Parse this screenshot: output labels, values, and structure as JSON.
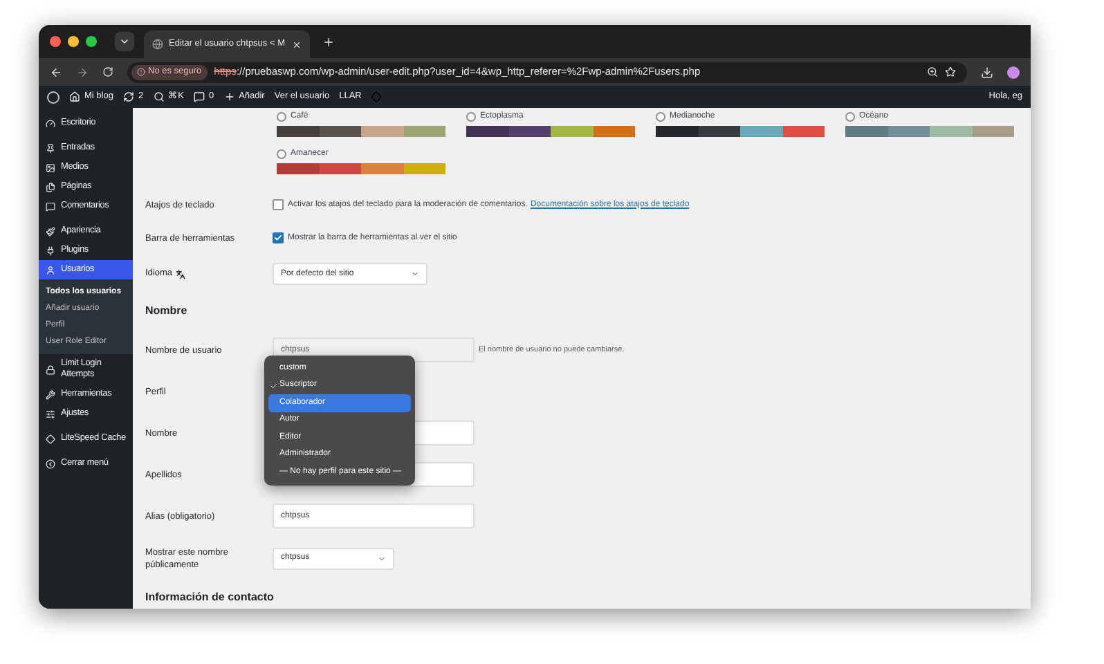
{
  "browser": {
    "tab_title": "Editar el usuario chtpsus < M",
    "security": "No es seguro",
    "url_scheme": "https",
    "url_rest": "://pruebaswp.com/wp-admin/user-edit.php?user_id=4&wp_http_referer=%2Fwp-admin%2Fusers.php"
  },
  "admin_bar": {
    "items": [
      {
        "kind": "logo"
      },
      {
        "kind": "home",
        "label": "Mi blog"
      },
      {
        "kind": "updates",
        "label": "2"
      },
      {
        "kind": "search",
        "label": "⌘K"
      },
      {
        "kind": "comments",
        "label": "0"
      },
      {
        "kind": "add",
        "label": "Añadir"
      },
      {
        "kind": "text",
        "label": "Ver el usuario"
      },
      {
        "kind": "text",
        "label": "LLAR"
      },
      {
        "kind": "diamond"
      }
    ],
    "greeting": "Hola, eg"
  },
  "sidebar": {
    "groups": [
      [
        {
          "label": "Escritorio",
          "selected": false
        }
      ],
      [
        {
          "label": "Entradas",
          "selected": false
        },
        {
          "label": "Medios",
          "selected": false
        },
        {
          "label": "Páginas",
          "selected": false
        },
        {
          "label": "Comentarios",
          "selected": false
        }
      ],
      [
        {
          "label": "Apariencia",
          "selected": false
        },
        {
          "label": "Plugins",
          "selected": false
        },
        {
          "label": "Usuarios",
          "selected": true,
          "children": [
            {
              "label": "Todos los usuarios",
              "selected": true
            },
            {
              "label": "Añadir usuario",
              "selected": false
            },
            {
              "label": "Perfil",
              "selected": false
            },
            {
              "label": "User Role Editor",
              "selected": false
            }
          ]
        },
        {
          "label": "Limit Login Attempts",
          "selected": false
        },
        {
          "label": "Herramientas",
          "selected": false
        },
        {
          "label": "Ajustes",
          "selected": false
        }
      ],
      [
        {
          "label": "LiteSpeed Cache",
          "selected": false
        }
      ],
      [
        {
          "label": "Cerrar menú",
          "selected": false
        }
      ]
    ]
  },
  "color_schemes": [
    {
      "name": "Café",
      "selected": false,
      "swatches": [
        {
          "color": "#46403c"
        },
        {
          "color": "#59524c"
        },
        {
          "color": "#c7a589"
        },
        {
          "color": "#9ea476"
        }
      ]
    },
    {
      "name": "Ectoplasma",
      "selected": false,
      "swatches": [
        {
          "color": "#413256"
        },
        {
          "color": "#523f6d"
        },
        {
          "color": "#a3b745"
        },
        {
          "color": "#d46f15"
        }
      ]
    },
    {
      "name": "Medianoche",
      "selected": false,
      "swatches": [
        {
          "color": "#25282b"
        },
        {
          "color": "#363b3f"
        },
        {
          "color": "#69a8bb"
        },
        {
          "color": "#e14d43"
        }
      ]
    },
    {
      "name": "Océano",
      "selected": false,
      "swatches": [
        {
          "color": "#627c83"
        },
        {
          "color": "#738e96"
        },
        {
          "color": "#9ebaa0"
        },
        {
          "color": "#aa9d88"
        }
      ]
    },
    {
      "name": "Amanecer",
      "selected": false,
      "swatches": [
        {
          "color": "#b43c38"
        },
        {
          "color": "#cf4944"
        },
        {
          "color": "#dd823b"
        },
        {
          "color": "#ccaf0b"
        }
      ]
    }
  ],
  "form": [
    {
      "kind": "checkbox",
      "label": "Atajos de teclado",
      "checked": false,
      "text": "Activar los atajos del teclado para la moderación de comentarios.",
      "link": "Documentación sobre los atajos de teclado"
    },
    {
      "kind": "checkbox",
      "label": "Barra de herramientas",
      "checked": true,
      "text": "Mostrar la barra de herramientas al ver el sitio"
    },
    {
      "kind": "language",
      "label": "Idioma",
      "value": "Por defecto del sitio"
    },
    {
      "kind": "heading",
      "label": "Nombre"
    },
    {
      "kind": "text",
      "label": "Nombre de usuario",
      "value": "chtpsus",
      "disabled": true,
      "hint": "El nombre de usuario no puede cambiarse."
    },
    {
      "kind": "role",
      "label": "Perfil",
      "options": [
        {
          "label": "custom",
          "checked": false,
          "highlighted": false
        },
        {
          "label": "Suscriptor",
          "checked": true,
          "highlighted": false
        },
        {
          "label": "Colaborador",
          "checked": false,
          "highlighted": true
        },
        {
          "label": "Autor",
          "checked": false,
          "highlighted": false
        },
        {
          "label": "Editor",
          "checked": false,
          "highlighted": false
        },
        {
          "label": "Administrador",
          "checked": false,
          "highlighted": false
        },
        {
          "label": "— No hay perfil para este sitio —",
          "checked": false,
          "highlighted": false
        }
      ]
    },
    {
      "kind": "text",
      "label": "Nombre",
      "disabled": false
    },
    {
      "kind": "text",
      "label": "Apellidos",
      "disabled": false
    },
    {
      "kind": "text",
      "label": "Alias (obligatorio)",
      "value": "chtpsus",
      "disabled": false
    },
    {
      "kind": "select",
      "label": "Mostrar este nombre públicamente",
      "value": "chtpsus"
    },
    {
      "kind": "heading",
      "label": "Información de contacto"
    }
  ]
}
